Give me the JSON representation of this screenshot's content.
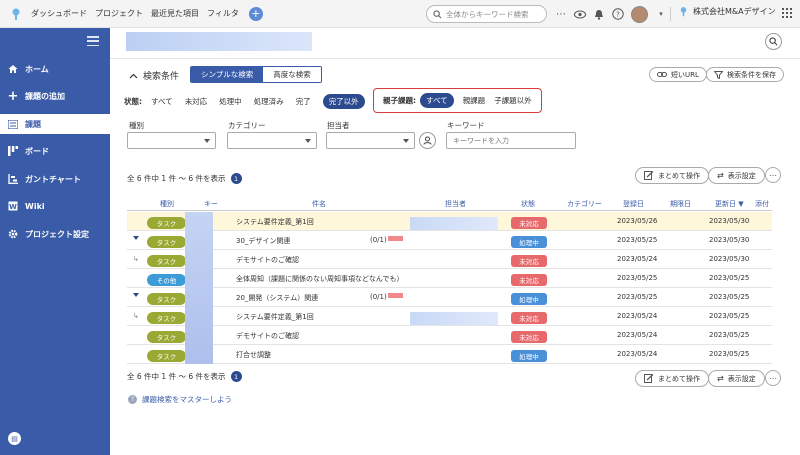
{
  "topbar": {
    "nav": [
      "ダッシュボード",
      "プロジェクト",
      "最近見た項目",
      "フィルタ"
    ],
    "add_label": "+",
    "search_placeholder": "全体からキーワード検索",
    "company": "株式会社M&Aデザイン"
  },
  "sidebar": {
    "items": [
      {
        "label": "ホーム",
        "icon": "home-icon"
      },
      {
        "label": "課題の追加",
        "icon": "plus-icon"
      },
      {
        "label": "課題",
        "icon": "list-icon",
        "active": true
      },
      {
        "label": "ボード",
        "icon": "board-icon"
      },
      {
        "label": "ガントチャート",
        "icon": "gantt-icon"
      },
      {
        "label": "Wiki",
        "icon": "wiki-icon"
      },
      {
        "label": "プロジェクト設定",
        "icon": "gear-icon"
      }
    ]
  },
  "conditions": {
    "title": "検索条件",
    "tab_simple": "シンプルな検索",
    "tab_advanced": "高度な検索",
    "short_url": "短いURL",
    "save": "検索条件を保存"
  },
  "status_filter": {
    "label": "状態:",
    "options": [
      "すべて",
      "未対応",
      "処理中",
      "処理済み",
      "完了"
    ],
    "active": "完了以外"
  },
  "parent_filter": {
    "label": "親子課題:",
    "active": "すべて",
    "options": [
      "親課題",
      "子課題以外"
    ]
  },
  "filters": {
    "type_label": "種別",
    "category_label": "カテゴリー",
    "assignee_label": "担当者",
    "keyword_label": "キーワード",
    "keyword_placeholder": "キーワードを入力"
  },
  "results": {
    "count_text": "全 6 件中 1 件 ～ 6 件を表示",
    "page": "1",
    "bulk": "まとめて操作",
    "display": "表示設定"
  },
  "table": {
    "headers": {
      "type": "種別",
      "key": "キー",
      "subject": "件名",
      "assignee": "担当者",
      "status": "状態",
      "category": "カテゴリー",
      "registered": "登録日",
      "due": "期限日",
      "updated": "更新日 ▼",
      "attach": "添付"
    },
    "rows": [
      {
        "type": "タスク",
        "subject": "システム要件定義_第1回",
        "status": "未対応",
        "registered": "2023/05/26",
        "updated": "2023/05/30"
      },
      {
        "type": "タスク",
        "subject": "30_デザイン関連",
        "sub": "(0/1)",
        "status": "処理中",
        "registered": "2023/05/25",
        "updated": "2023/05/30"
      },
      {
        "type": "タスク",
        "subject": "デモサイトのご確認",
        "status": "未対応",
        "registered": "2023/05/24",
        "updated": "2023/05/30"
      },
      {
        "type": "その他",
        "subject": "全体周知（課題に関係のない周知事項などなんでも）",
        "status": "未対応",
        "registered": "2023/05/25",
        "updated": "2023/05/25"
      },
      {
        "type": "タスク",
        "subject": "20_開発（システム）関連",
        "sub": "(0/1)",
        "status": "処理中",
        "registered": "2023/05/25",
        "updated": "2023/05/25"
      },
      {
        "type": "タスク",
        "subject": "システム要件定義_第1回",
        "status": "未対応",
        "registered": "2023/05/24",
        "updated": "2023/05/25"
      },
      {
        "type": "タスク",
        "subject": "デモサイトのご確認",
        "status": "未対応",
        "registered": "2023/05/24",
        "updated": "2023/05/25"
      },
      {
        "type": "タスク",
        "subject": "打合せ調整",
        "status": "処理中",
        "registered": "2023/05/24",
        "updated": "2023/05/25"
      }
    ]
  },
  "footer": {
    "help": "課題検索をマスターしよう"
  },
  "colors": {
    "brand": "#3a5ca8",
    "task": "#9aa934",
    "other": "#3d9bd8",
    "open": "#e8696c",
    "in_progress": "#4a90d9",
    "highlight": "#d83b3b"
  }
}
